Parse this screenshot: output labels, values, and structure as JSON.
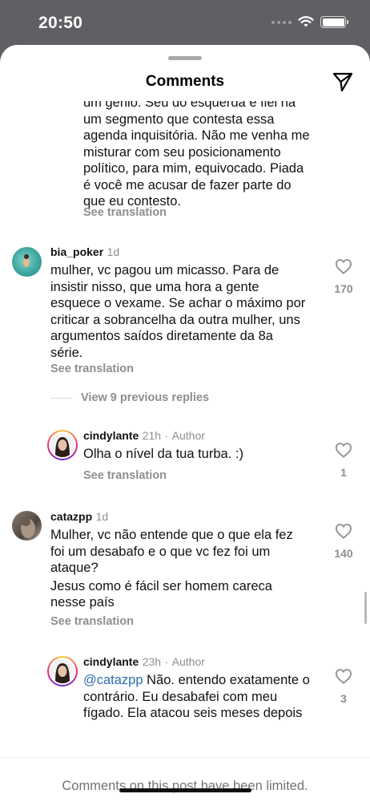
{
  "status_bar": {
    "time": "20:50"
  },
  "header": {
    "title": "Comments"
  },
  "top_comment_tail": {
    "lines": [
      "um gênio. Seu do esquerda é fiel na",
      "um segmento que contesta essa",
      "agenda inquisitória. Não me venha me",
      "misturar com seu posicionamento",
      "político, para mim, equivocado. Piada",
      "é você me acusar de fazer parte do",
      "que eu contesto."
    ],
    "see_translation": "See translation"
  },
  "comments": [
    {
      "username": "bia_poker",
      "time": "1d",
      "text_lines": [
        "mulher, vc pagou um micasso. Para de",
        "insistir nisso, que uma hora a gente",
        "esquece o vexame. Se achar o máximo por",
        "criticar a sobrancelha da outra mulher, uns",
        "argumentos saídos diretamente da 8a",
        "série."
      ],
      "see_translation": "See translation",
      "likes": "170",
      "view_replies": "View 9 previous replies"
    },
    {
      "username": "cindylante",
      "time": "21h",
      "role": "Author",
      "text": "Olha o nível da tua turba. :)",
      "see_translation": "See translation",
      "likes": "1"
    },
    {
      "username": "catazpp",
      "time": "1d",
      "text_lines": [
        "Mulher, vc não entende que o que ela fez",
        "foi um desabafo e o que vc fez foi um",
        "ataque?"
      ],
      "text_lines_2": [
        "Jesus como é fácil ser homem careca",
        "nesse país"
      ],
      "see_translation": "See translation",
      "likes": "140"
    },
    {
      "username": "cindylante",
      "time": "23h",
      "role": "Author",
      "mention": "@catazpp",
      "first_line_rest": " Não. entendo exatamente o",
      "text_lines": [
        "contrário. Eu desabafei com meu",
        "fígado. Ela atacou seis meses depois"
      ],
      "likes": "3"
    }
  ],
  "meta_separator": "·",
  "footer": {
    "note": "Comments on this post have been limited."
  },
  "icons": {
    "send": "paper-plane-icon",
    "heart": "heart-outline-icon",
    "wifi": "wifi-icon",
    "battery": "battery-icon"
  },
  "colors": {
    "status_bar_bg": "#5f6063",
    "sheet_bg": "#ffffff",
    "secondary_text": "#8e8e93",
    "mention": "#2b6cb0"
  }
}
